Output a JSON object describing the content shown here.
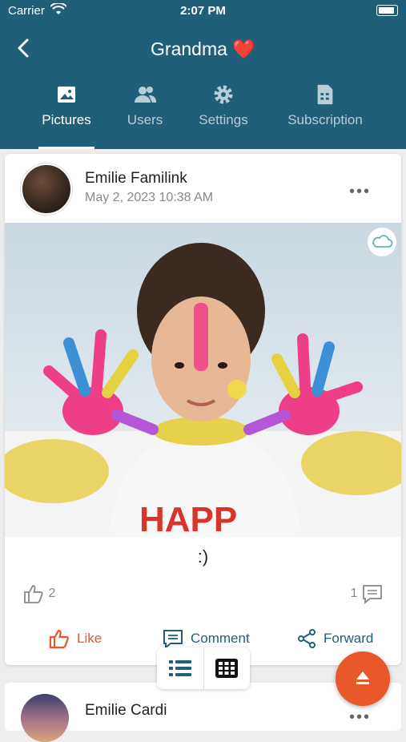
{
  "status": {
    "carrier": "Carrier",
    "time": "2:07 PM"
  },
  "nav": {
    "title": "Grandma",
    "title_emoji": "❤️"
  },
  "tabs": [
    {
      "label": "Pictures",
      "icon": "image-icon",
      "active": true
    },
    {
      "label": "Users",
      "icon": "users-icon",
      "active": false
    },
    {
      "label": "Settings",
      "icon": "gear-icon",
      "active": false
    },
    {
      "label": "Subscription",
      "icon": "sim-card-icon",
      "active": false
    }
  ],
  "post": {
    "author": "Emilie Familink",
    "date": "May 2, 2023 10:38 AM",
    "caption": ":)",
    "like_count": "2",
    "comment_count": "1",
    "actions": {
      "like": "Like",
      "comment": "Comment",
      "forward": "Forward"
    }
  },
  "next_post": {
    "author": "Emilie Cardi"
  },
  "colors": {
    "header": "#1f5f79",
    "accent": "#e8582a",
    "teal": "#1f5f79"
  }
}
